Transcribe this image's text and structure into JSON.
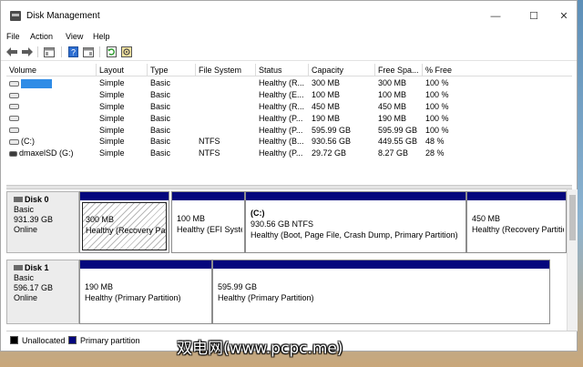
{
  "window": {
    "title": "Disk Management",
    "controls": {
      "minimize": "—",
      "maximize": "☐",
      "close": "✕"
    }
  },
  "menu": [
    "File",
    "Action",
    "View",
    "Help"
  ],
  "toolbar": {
    "buttons": [
      "back-arrow-icon",
      "forward-arrow-icon",
      "properties-pane-icon",
      "help-icon",
      "console-tree-icon",
      "refresh-icon",
      "settings-icon"
    ]
  },
  "volume_table": {
    "columns": [
      "Volume",
      "Layout",
      "Type",
      "File System",
      "Status",
      "Capacity",
      "Free Spa...",
      "% Free"
    ],
    "rows": [
      {
        "volume": "",
        "layout": "Simple",
        "type": "Basic",
        "fs": "",
        "status": "Healthy (R...",
        "capacity": "300 MB",
        "free": "300 MB",
        "pct": "100 %",
        "icon": "drive",
        "selected": true
      },
      {
        "volume": "",
        "layout": "Simple",
        "type": "Basic",
        "fs": "",
        "status": "Healthy (E...",
        "capacity": "100 MB",
        "free": "100 MB",
        "pct": "100 %",
        "icon": "drive",
        "selected": false
      },
      {
        "volume": "",
        "layout": "Simple",
        "type": "Basic",
        "fs": "",
        "status": "Healthy (R...",
        "capacity": "450 MB",
        "free": "450 MB",
        "pct": "100 %",
        "icon": "drive",
        "selected": false
      },
      {
        "volume": "",
        "layout": "Simple",
        "type": "Basic",
        "fs": "",
        "status": "Healthy (P...",
        "capacity": "190 MB",
        "free": "190 MB",
        "pct": "100 %",
        "icon": "drive",
        "selected": false
      },
      {
        "volume": "",
        "layout": "Simple",
        "type": "Basic",
        "fs": "",
        "status": "Healthy (P...",
        "capacity": "595.99 GB",
        "free": "595.99 GB",
        "pct": "100 %",
        "icon": "drive",
        "selected": false
      },
      {
        "volume": "(C:)",
        "layout": "Simple",
        "type": "Basic",
        "fs": "NTFS",
        "status": "Healthy (B...",
        "capacity": "930.56 GB",
        "free": "449.55 GB",
        "pct": "48 %",
        "icon": "drive",
        "selected": false
      },
      {
        "volume": "dmaxelSD (G:)",
        "layout": "Simple",
        "type": "Basic",
        "fs": "NTFS",
        "status": "Healthy (P...",
        "capacity": "29.72 GB",
        "free": "8.27 GB",
        "pct": "28 %",
        "icon": "usb",
        "selected": false
      }
    ]
  },
  "disks": [
    {
      "name": "Disk 0",
      "type": "Basic",
      "size": "931.39 GB",
      "state": "Online",
      "partitions": [
        {
          "label": "",
          "size": "300 MB",
          "status": "Healthy (Recovery Partition)",
          "hatched": true
        },
        {
          "label": "",
          "size": "100 MB",
          "status": "Healthy (EFI System Partition)",
          "hatched": false
        },
        {
          "label": "(C:)",
          "size": "930.56 GB NTFS",
          "status": "Healthy (Boot, Page File, Crash Dump, Primary Partition)",
          "hatched": false
        },
        {
          "label": "",
          "size": "450 MB",
          "status": "Healthy (Recovery Partition)",
          "hatched": false
        }
      ]
    },
    {
      "name": "Disk 1",
      "type": "Basic",
      "size": "596.17 GB",
      "state": "Online",
      "partitions": [
        {
          "label": "",
          "size": "190 MB",
          "status": "Healthy (Primary Partition)",
          "hatched": false
        },
        {
          "label": "",
          "size": "595.99 GB",
          "status": "Healthy (Primary Partition)",
          "hatched": false
        }
      ]
    }
  ],
  "legend": [
    {
      "label": "Unallocated",
      "color": "#000000"
    },
    {
      "label": "Primary partition",
      "color": "#05077d"
    }
  ],
  "watermark": "双电网(www.pcpc.me)"
}
